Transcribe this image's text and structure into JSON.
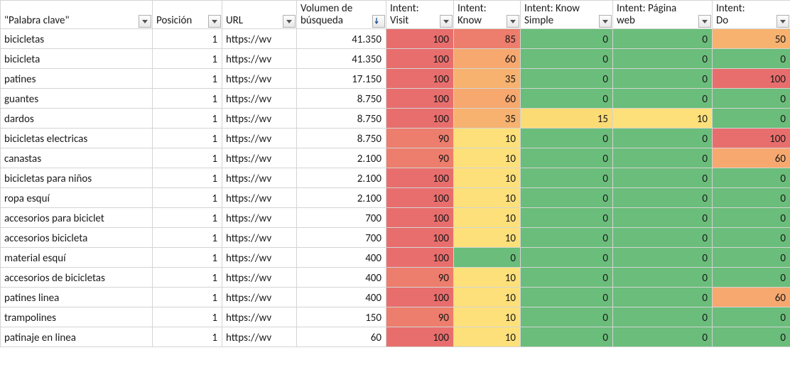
{
  "headers": {
    "keyword": {
      "line1": "",
      "line2": "\"Palabra clave\""
    },
    "position": {
      "line1": "",
      "line2": "Posición"
    },
    "url": {
      "line1": "",
      "line2": "URL"
    },
    "volume": {
      "line1": "Volumen de",
      "line2": "búsqueda"
    },
    "visit": {
      "line1": "Intent:",
      "line2": "Visit"
    },
    "know": {
      "line1": "Intent:",
      "line2": "Know"
    },
    "knowsimple": {
      "line1": "Intent: Know",
      "line2": "Simple"
    },
    "web": {
      "line1": "Intent: Página",
      "line2": "web"
    },
    "do": {
      "line1": "Intent:",
      "line2": "Do"
    }
  },
  "chart_data": {
    "type": "table",
    "title": "",
    "columns": [
      "Palabra clave",
      "Posición",
      "URL",
      "Volumen de búsqueda",
      "Intent: Visit",
      "Intent: Know",
      "Intent: Know Simple",
      "Intent: Página web",
      "Intent: Do"
    ],
    "color_scale": {
      "low": "#6abd7a",
      "mid": "#fde07a",
      "high": "#e86e6d",
      "applies_to": [
        "Intent: Visit",
        "Intent: Know",
        "Intent: Know Simple",
        "Intent: Página web",
        "Intent: Do"
      ]
    },
    "rows": [
      {
        "keyword": "bicicletas",
        "position": 1,
        "url": "https://wv",
        "volume": "41.350",
        "visit": 100,
        "know": 85,
        "knowsimple": 0,
        "web": 0,
        "do": 50
      },
      {
        "keyword": "bicicleta",
        "position": 1,
        "url": "https://wv",
        "volume": "41.350",
        "visit": 100,
        "know": 60,
        "knowsimple": 0,
        "web": 0,
        "do": 0
      },
      {
        "keyword": "patines",
        "position": 1,
        "url": "https://wv",
        "volume": "17.150",
        "visit": 100,
        "know": 35,
        "knowsimple": 0,
        "web": 0,
        "do": 100
      },
      {
        "keyword": "guantes",
        "position": 1,
        "url": "https://wv",
        "volume": "8.750",
        "visit": 100,
        "know": 60,
        "knowsimple": 0,
        "web": 0,
        "do": 0
      },
      {
        "keyword": "dardos",
        "position": 1,
        "url": "https://wv",
        "volume": "8.750",
        "visit": 100,
        "know": 35,
        "knowsimple": 15,
        "web": 10,
        "do": 0
      },
      {
        "keyword": "bicicletas electricas",
        "position": 1,
        "url": "https://wv",
        "volume": "8.750",
        "visit": 90,
        "know": 10,
        "knowsimple": 0,
        "web": 0,
        "do": 100
      },
      {
        "keyword": "canastas",
        "position": 1,
        "url": "https://wv",
        "volume": "2.100",
        "visit": 90,
        "know": 10,
        "knowsimple": 0,
        "web": 0,
        "do": 60
      },
      {
        "keyword": "bicicletas para niños",
        "position": 1,
        "url": "https://wv",
        "volume": "2.100",
        "visit": 100,
        "know": 10,
        "knowsimple": 0,
        "web": 0,
        "do": 0
      },
      {
        "keyword": "ropa esquí",
        "position": 1,
        "url": "https://wv",
        "volume": "2.100",
        "visit": 100,
        "know": 10,
        "knowsimple": 0,
        "web": 0,
        "do": 0
      },
      {
        "keyword": "accesorios para biciclet",
        "position": 1,
        "url": "https://wv",
        "volume": "700",
        "visit": 100,
        "know": 10,
        "knowsimple": 0,
        "web": 0,
        "do": 0
      },
      {
        "keyword": "accesorios bicicleta",
        "position": 1,
        "url": "https://wv",
        "volume": "700",
        "visit": 100,
        "know": 10,
        "knowsimple": 0,
        "web": 0,
        "do": 0
      },
      {
        "keyword": "material esquí",
        "position": 1,
        "url": "https://wv",
        "volume": "400",
        "visit": 100,
        "know": 0,
        "knowsimple": 0,
        "web": 0,
        "do": 0
      },
      {
        "keyword": "accesorios de bicicletas",
        "position": 1,
        "url": "https://wv",
        "volume": "400",
        "visit": 90,
        "know": 10,
        "knowsimple": 0,
        "web": 0,
        "do": 0
      },
      {
        "keyword": "patines linea",
        "position": 1,
        "url": "https://wv",
        "volume": "400",
        "visit": 100,
        "know": 10,
        "knowsimple": 0,
        "web": 0,
        "do": 60
      },
      {
        "keyword": "trampolines",
        "position": 1,
        "url": "https://wv",
        "volume": "150",
        "visit": 90,
        "know": 10,
        "knowsimple": 0,
        "web": 0,
        "do": 0
      },
      {
        "keyword": "patinaje en linea",
        "position": 1,
        "url": "https://wv",
        "volume": "60",
        "visit": 100,
        "know": 10,
        "knowsimple": 0,
        "web": 0,
        "do": 0
      }
    ]
  },
  "icons": {
    "filter": "filter-dropdown-icon",
    "sort_desc": "sort-descending-icon"
  }
}
